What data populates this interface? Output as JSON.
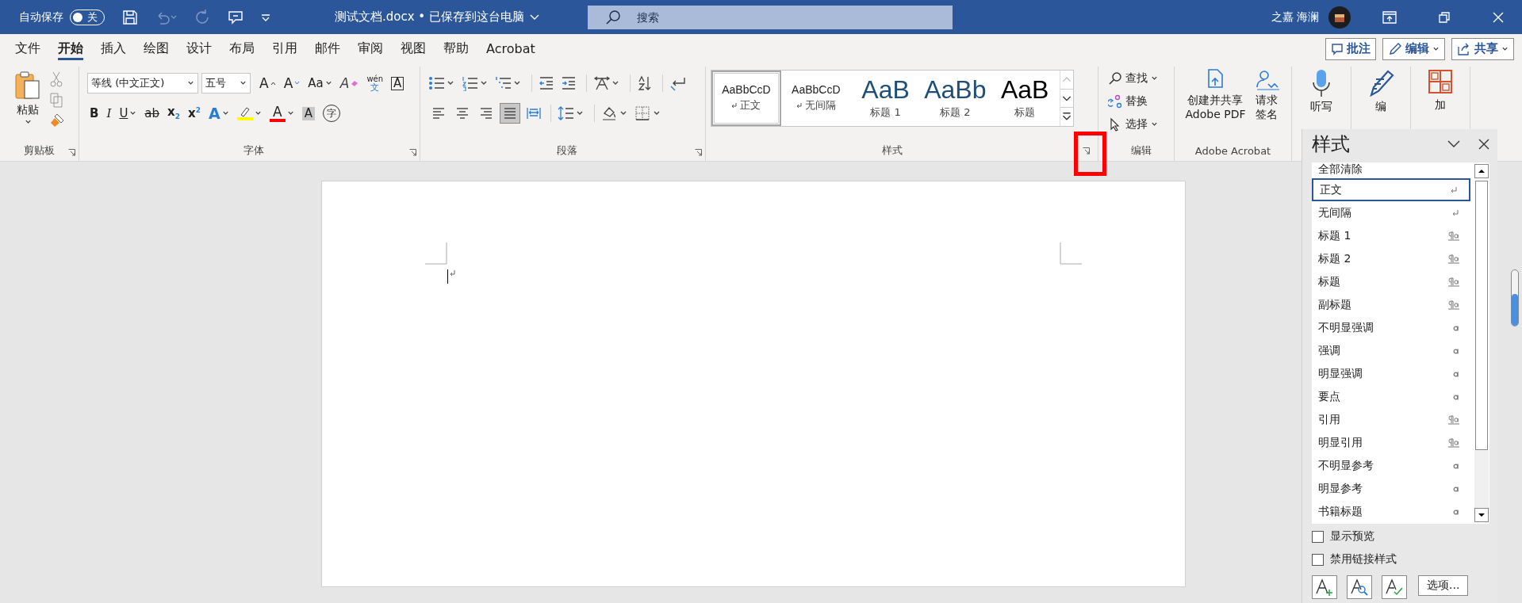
{
  "title_bar": {
    "autosave_label": "自动保存",
    "autosave_toggle": {
      "label": "关",
      "on": false
    },
    "document_title": "测试文档.docx • 已保存到这台电脑",
    "search_placeholder": "搜索",
    "user_name": "之嘉 海澜"
  },
  "menu_tabs": [
    {
      "label": "文件",
      "selected": false
    },
    {
      "label": "开始",
      "selected": true
    },
    {
      "label": "插入",
      "selected": false
    },
    {
      "label": "绘图",
      "selected": false
    },
    {
      "label": "设计",
      "selected": false
    },
    {
      "label": "布局",
      "selected": false
    },
    {
      "label": "引用",
      "selected": false
    },
    {
      "label": "邮件",
      "selected": false
    },
    {
      "label": "审阅",
      "selected": false
    },
    {
      "label": "视图",
      "selected": false
    },
    {
      "label": "帮助",
      "selected": false
    },
    {
      "label": "Acrobat",
      "selected": false
    }
  ],
  "header_buttons": [
    {
      "label": "批注",
      "kind": "comment",
      "dropdown": false
    },
    {
      "label": "编辑",
      "kind": "edit",
      "dropdown": true
    },
    {
      "label": "共享",
      "kind": "share",
      "dropdown": true
    }
  ],
  "clipboard": {
    "group_label": "剪贴板",
    "paste_label": "粘贴"
  },
  "font": {
    "group_label": "字体",
    "font_name": "等线 (中文正文)",
    "font_size": "五号",
    "row_1": [
      {
        "kind": "grow",
        "glyph": "A",
        "dropdown": false
      },
      {
        "kind": "shrink",
        "glyph": "A",
        "dropdown": false
      },
      {
        "kind": "case",
        "glyph": "Aa",
        "dropdown": true
      },
      {
        "kind": "clear",
        "glyph": "A",
        "dropdown": false
      },
      {
        "kind": "phonetic",
        "glyph": "wén",
        "sub": "文",
        "dropdown": false
      },
      {
        "kind": "border",
        "glyph": "A",
        "dropdown": false
      }
    ],
    "row_2": [
      {
        "kind": "bold",
        "glyph": "B",
        "dropdown": false
      },
      {
        "kind": "italic",
        "glyph": "I",
        "dropdown": false
      },
      {
        "kind": "underline",
        "glyph": "U",
        "dropdown": true
      },
      {
        "kind": "strike",
        "glyph": "ab",
        "dropdown": false
      },
      {
        "kind": "subscript",
        "glyph": "x",
        "sub": "2",
        "dropdown": false
      },
      {
        "kind": "superscript",
        "glyph": "x",
        "sub": "2",
        "dropdown": false
      },
      {
        "kind": "effects",
        "glyph": "A",
        "dropdown": true
      },
      {
        "kind": "highlight",
        "color": "#ffff00",
        "dropdown": true
      },
      {
        "kind": "color",
        "glyph": "A",
        "color": "#ff0000",
        "dropdown": true
      },
      {
        "kind": "shading",
        "glyph": "A",
        "dropdown": false
      },
      {
        "kind": "enclose",
        "glyph": "字",
        "dropdown": false
      }
    ]
  },
  "paragraph": {
    "group_label": "段落",
    "alignment": [
      {
        "kind": "left",
        "selected": false
      },
      {
        "kind": "center",
        "selected": false
      },
      {
        "kind": "right",
        "selected": false
      },
      {
        "kind": "justify",
        "selected": true
      },
      {
        "kind": "distributed",
        "selected": false
      }
    ]
  },
  "styles_gallery": {
    "group_label": "样式",
    "items": [
      {
        "preview": "AaBbCcD",
        "name": "正文",
        "kind": "body",
        "paragraph_mark": true,
        "selected": true
      },
      {
        "preview": "AaBbCcD",
        "name": "无间隔",
        "kind": "body",
        "paragraph_mark": true,
        "selected": false
      },
      {
        "preview": "AaB",
        "name": "标题 1",
        "kind": "heading",
        "paragraph_mark": false,
        "selected": false
      },
      {
        "preview": "AaBb",
        "name": "标题 2",
        "kind": "heading",
        "paragraph_mark": false,
        "selected": false
      },
      {
        "preview": "AaB",
        "name": "标题",
        "kind": "title",
        "paragraph_mark": false,
        "selected": false
      }
    ]
  },
  "editing": {
    "group_label": "编辑",
    "commands": [
      {
        "label": "查找",
        "kind": "find",
        "dropdown": true
      },
      {
        "label": "替换",
        "kind": "replace",
        "dropdown": false
      },
      {
        "label": "选择",
        "kind": "select",
        "dropdown": true
      }
    ]
  },
  "acrobat": {
    "group_label": "Adobe Acrobat",
    "commands": [
      {
        "label": "创建并共享\nAdobe PDF",
        "kind": "create_pdf"
      },
      {
        "label": "请求签名",
        "kind": "sign"
      }
    ]
  },
  "extra_commands": [
    {
      "label": "听写",
      "kind": "dictate"
    },
    {
      "label": "编",
      "kind": "editor"
    },
    {
      "label": "加",
      "kind": "addins"
    }
  ],
  "styles_pane": {
    "title": "样式",
    "items": [
      {
        "name": "全部清除",
        "kind": "clear",
        "selected": false
      },
      {
        "name": "正文",
        "kind": "paragraph",
        "selected": true
      },
      {
        "name": "无间隔",
        "kind": "paragraph",
        "selected": false
      },
      {
        "name": "标题 1",
        "kind": "linked",
        "selected": false
      },
      {
        "name": "标题 2",
        "kind": "linked",
        "selected": false
      },
      {
        "name": "标题",
        "kind": "linked",
        "selected": false
      },
      {
        "name": "副标题",
        "kind": "linked",
        "selected": false
      },
      {
        "name": "不明显强调",
        "kind": "character",
        "selected": false
      },
      {
        "name": "强调",
        "kind": "character",
        "selected": false
      },
      {
        "name": "明显强调",
        "kind": "character",
        "selected": false
      },
      {
        "name": "要点",
        "kind": "character",
        "selected": false
      },
      {
        "name": "引用",
        "kind": "linked",
        "selected": false
      },
      {
        "name": "明显引用",
        "kind": "linked",
        "selected": false
      },
      {
        "name": "不明显参考",
        "kind": "character",
        "selected": false
      },
      {
        "name": "明显参考",
        "kind": "character",
        "selected": false
      },
      {
        "name": "书籍标题",
        "kind": "character",
        "selected": false
      }
    ],
    "show_preview": {
      "label": "显示预览",
      "checked": false
    },
    "disable_linked": {
      "label": "禁用链接样式",
      "checked": false
    },
    "options_button": "选项..."
  }
}
